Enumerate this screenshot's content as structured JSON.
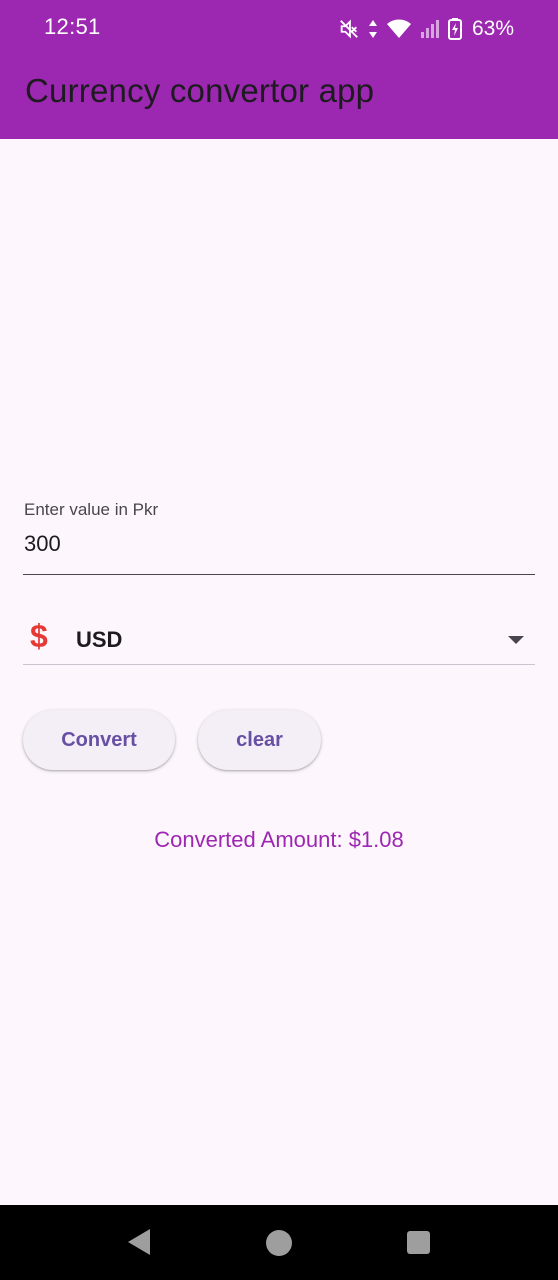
{
  "status_bar": {
    "time": "12:51",
    "battery_percent": "63%",
    "icons": [
      "mute-icon",
      "data-arrows-icon",
      "wifi-icon",
      "signal-icon",
      "battery-charging-icon"
    ]
  },
  "app_bar": {
    "title": "Currency convertor app",
    "color": "#9c27b0"
  },
  "form": {
    "input_label": "Enter value in Pkr",
    "input_value": "300",
    "currency_symbol": "$",
    "currency_selected": "USD",
    "currency_icon": "dollar-icon",
    "dropdown_icon": "dropdown-arrow-icon"
  },
  "buttons": {
    "convert_label": "Convert",
    "clear_label": "clear"
  },
  "result": {
    "text": "Converted Amount: $1.08"
  },
  "nav_bar": {
    "icons": [
      "back-icon",
      "home-icon",
      "recents-icon"
    ]
  }
}
